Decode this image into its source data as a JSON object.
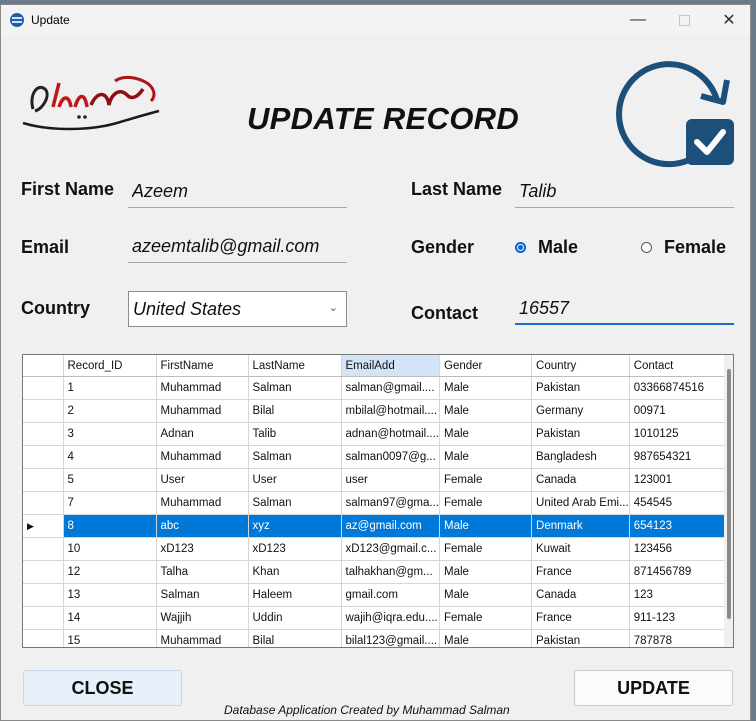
{
  "window": {
    "title": "Update"
  },
  "heading": "UPDATE RECORD",
  "form": {
    "first_name_label": "First Name",
    "first_name_value": "Azeem",
    "last_name_label": "Last Name",
    "last_name_value": "Talib",
    "email_label": "Email",
    "email_value": "azeemtalib@gmail.com",
    "gender_label": "Gender",
    "gender_male": "Male",
    "gender_female": "Female",
    "gender_selected": "Male",
    "country_label": "Country",
    "country_value": "United States",
    "contact_label": "Contact",
    "contact_value": "16557"
  },
  "table": {
    "columns": [
      "Record_ID",
      "FirstName",
      "LastName",
      "EmailAdd",
      "Gender",
      "Country",
      "Contact"
    ],
    "sorted_column": "EmailAdd",
    "selected_row": "8",
    "rows": [
      [
        "1",
        "Muhammad",
        "Salman",
        "salman@gmail....",
        "Male",
        "Pakistan",
        "03366874516"
      ],
      [
        "2",
        "Muhammad",
        "Bilal",
        "mbilal@hotmail....",
        "Male",
        "Germany",
        "00971"
      ],
      [
        "3",
        "Adnan",
        "Talib",
        "adnan@hotmail....",
        "Male",
        "Pakistan",
        "1010125"
      ],
      [
        "4",
        "Muhammad",
        "Salman",
        "salman0097@g...",
        "Male",
        "Bangladesh",
        "987654321"
      ],
      [
        "5",
        "User",
        "User",
        "user",
        "Female",
        "Canada",
        "123001"
      ],
      [
        "7",
        "Muhammad",
        "Salman",
        "salman97@gma...",
        "Female",
        "United Arab Emi...",
        "454545"
      ],
      [
        "8",
        "abc",
        "xyz",
        "az@gmail.com",
        "Male",
        "Denmark",
        "654123"
      ],
      [
        "10",
        "xD123",
        "xD123",
        "xD123@gmail.c...",
        "Female",
        "Kuwait",
        "123456"
      ],
      [
        "12",
        "Talha",
        "Khan",
        "talhakhan@gm...",
        "Male",
        "France",
        "871456789"
      ],
      [
        "13",
        "Salman",
        "Haleem",
        "gmail.com",
        "Male",
        "Canada",
        "123"
      ],
      [
        "14",
        "Wajjih",
        "Uddin",
        "wajih@iqra.edu....",
        "Female",
        "France",
        "911-123"
      ],
      [
        "15",
        "Muhammad",
        "Bilal",
        "bilal123@gmail....",
        "Male",
        "Pakistan",
        "787878"
      ]
    ]
  },
  "buttons": {
    "close": "CLOSE",
    "update": "UPDATE"
  },
  "footer": "Database Application Created by Muhammad Salman",
  "colors": {
    "accent": "#0078d7",
    "icon_blue": "#1c4f7a"
  }
}
